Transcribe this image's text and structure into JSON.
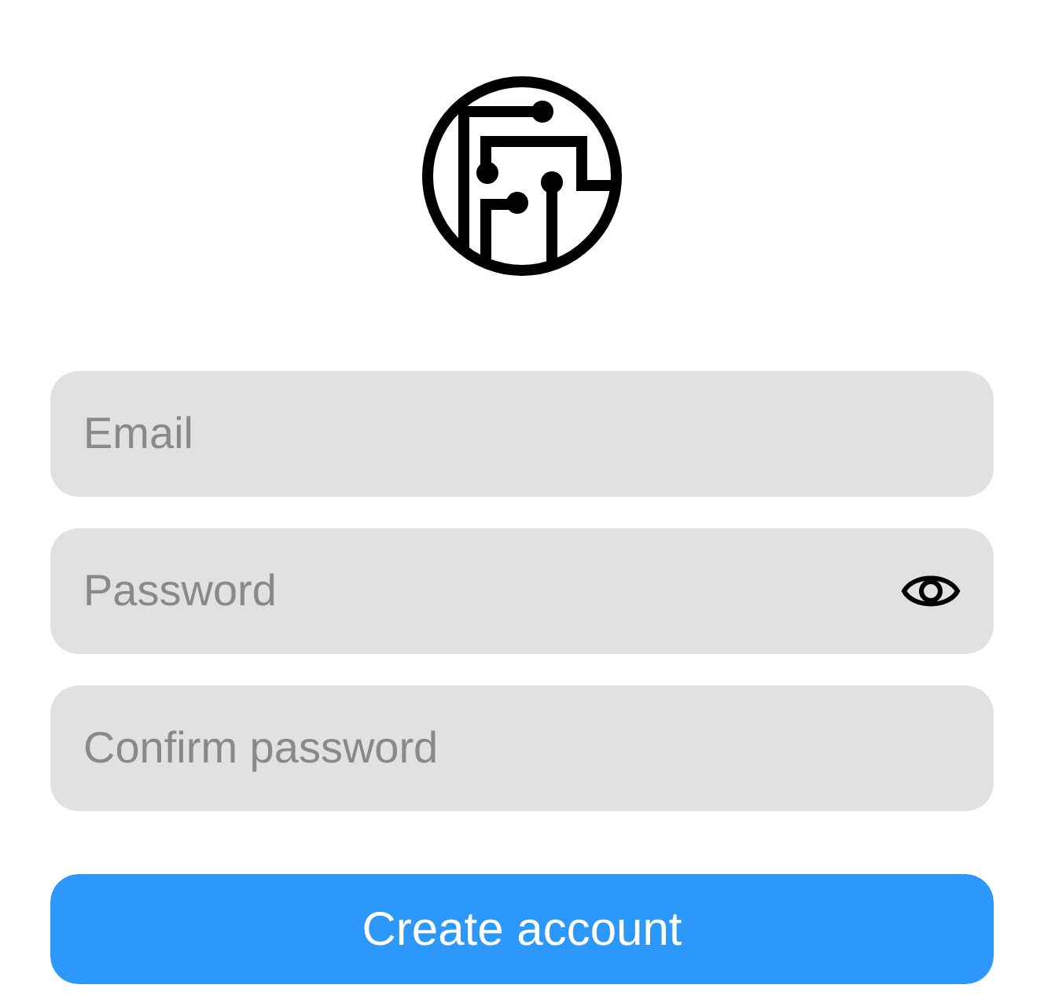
{
  "fields": [
    {
      "kind": "text",
      "placeholder": "Email"
    },
    {
      "kind": "password",
      "placeholder": "Password"
    },
    {
      "kind": "text",
      "placeholder": "Confirm password"
    }
  ],
  "submit": {
    "label": "Create account"
  }
}
